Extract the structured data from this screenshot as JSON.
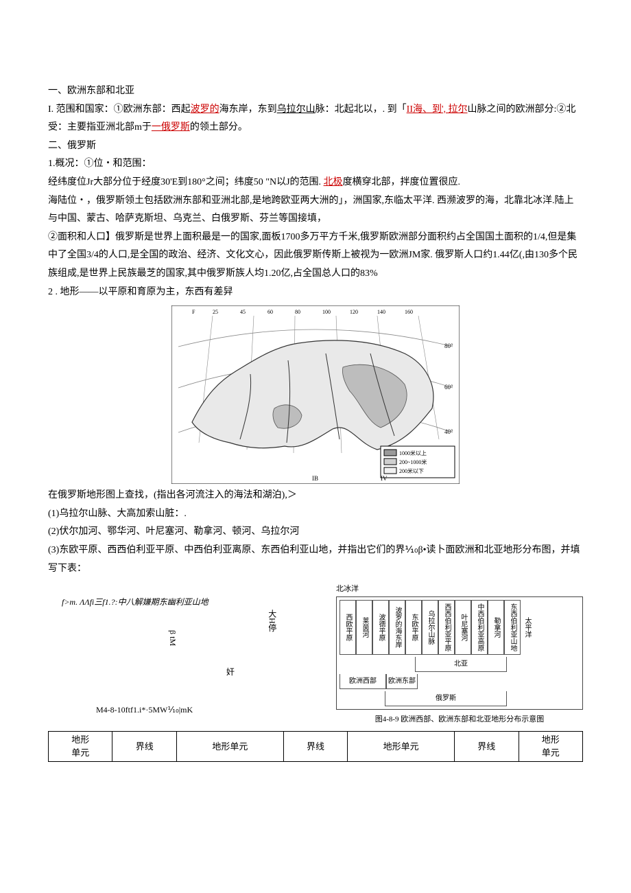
{
  "section1": {
    "title": "一、欧洲东部和北亚",
    "p1_a": "I. 范围和国家：①欧洲东部：西起",
    "p1_red1": "波罗的",
    "p1_b": "海东岸，东到",
    "p1_u1": "乌拉尔山",
    "p1_c": "脉：北起北以，. 到「",
    "p1_red2": "II海、到', 拉尔",
    "p1_d": "山脉之间的欧洲部分:②北受：主要指亚洲北部m于",
    "p1_red3": "一俄罗斯",
    "p1_e": "的领土部分。"
  },
  "section2": {
    "title": "二、俄罗斯",
    "h1": "1.概况：①位・和范围：",
    "p2a": "经纬度位Jr大部分位于经度30'E到180°之间；纬度50 \"N以J的范围. ",
    "p2a_red": "北极",
    "p2a_b": "度横穿北部，拌度位置很应.",
    "p3": "海陆位・，俄罗斯领土包括欧洲东部和亚洲北部,是地跨欧亚两大洲的」，洲国家,东临太平洋. 西濒波罗的海，北靠北冰洋.陆上与中国、蒙古、哈萨克斯坦、乌克兰、白俄罗斯、芬兰等国接填，",
    "p4": "②面积和人口】俄罗斯是世界上面积最是一的国家,面板1700多万平方千米,俄罗斯欧洲部分面积约占全国国土面积的1/4,但是集中了全国3/4的人口,是全国的政治、经济、文化文心，因此俄罗斯传斯上被视为一欧洲JM家. 俄罗斯人口约1.44亿(,由130多个民族组成,是世界上民族最芝的国家,其中俄罗斯族人均1.20亿,占全国总人口的83%",
    "h2": "2 . 地形——以平原和育原为主，东西有差舁",
    "after_map_intro": "在俄罗斯地形图上查找，(指出各河流注入的海法和湖泊),＞",
    "q1": "(1)乌拉尔山脉、大高加索山脏：.",
    "q2": "(2)伏尔加河、鄂华河、叶尼塞河、勒拿河、顿河、乌拉尔河",
    "q3": "(3)东欧平原、西西伯利亚平原、中西伯利亚离原、东西伯利亚山地，并指出它们的界⅒β•读卜面欧洲和北亚地形分布图，并填写下表："
  },
  "map": {
    "legend1": "1000米以上",
    "legend2": "200~1000米",
    "legend3": "200米以下",
    "top_ticks": [
      "F",
      "25",
      "45",
      "60",
      "80",
      "100",
      "120",
      "140",
      "160"
    ],
    "side_ticks": [
      "80°",
      "60°",
      "40°"
    ],
    "bottom": [
      "IB",
      "IV"
    ]
  },
  "left_fig": {
    "line1": "f>m. ΛΛfi三f1.?:中八解嫌期东幽利亚山地",
    "v1": "大H停",
    "v2": "β tM",
    "v3": "奸",
    "caption": "M4-8-10ftf1.i*·5MW⅒|mK"
  },
  "diagram": {
    "top": "北冰洋",
    "cols": [
      "西欧平原",
      "莱茵河",
      "波德平原",
      "波罗的海东岸",
      "东欧平原",
      "乌拉尔山脉",
      "西西伯利亚平原",
      "叶尼塞河",
      "中西伯利亚高原",
      "勒拿河",
      "东西伯利亚山地"
    ],
    "right": "太平洋",
    "b_na": "北亚",
    "b_euw": "欧洲西部",
    "b_eue": "欧洲东部",
    "b_ru": "俄罗斯",
    "caption": "图4-8-9 欧洲西部、欧洲东部和北亚地形分布示意图"
  },
  "table_headers": {
    "c1a": "地形",
    "c1b": "单元",
    "c2": "界线",
    "c3": "地形单元",
    "c4": "界线",
    "c5": "地形单元",
    "c6": "界线",
    "c7a": "地形",
    "c7b": "单元"
  }
}
